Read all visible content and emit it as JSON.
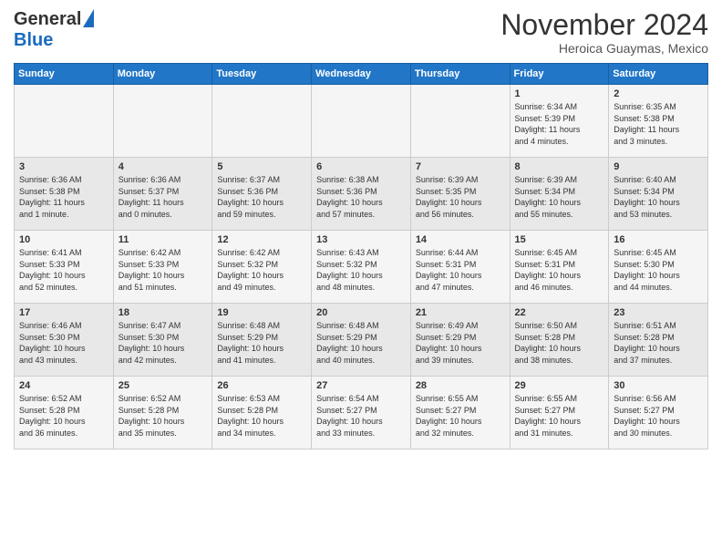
{
  "header": {
    "logo_general": "General",
    "logo_blue": "Blue",
    "month_title": "November 2024",
    "location": "Heroica Guaymas, Mexico"
  },
  "days_of_week": [
    "Sunday",
    "Monday",
    "Tuesday",
    "Wednesday",
    "Thursday",
    "Friday",
    "Saturday"
  ],
  "weeks": [
    [
      {
        "day": "",
        "info": ""
      },
      {
        "day": "",
        "info": ""
      },
      {
        "day": "",
        "info": ""
      },
      {
        "day": "",
        "info": ""
      },
      {
        "day": "",
        "info": ""
      },
      {
        "day": "1",
        "info": "Sunrise: 6:34 AM\nSunset: 5:39 PM\nDaylight: 11 hours\nand 4 minutes."
      },
      {
        "day": "2",
        "info": "Sunrise: 6:35 AM\nSunset: 5:38 PM\nDaylight: 11 hours\nand 3 minutes."
      }
    ],
    [
      {
        "day": "3",
        "info": "Sunrise: 6:36 AM\nSunset: 5:38 PM\nDaylight: 11 hours\nand 1 minute."
      },
      {
        "day": "4",
        "info": "Sunrise: 6:36 AM\nSunset: 5:37 PM\nDaylight: 11 hours\nand 0 minutes."
      },
      {
        "day": "5",
        "info": "Sunrise: 6:37 AM\nSunset: 5:36 PM\nDaylight: 10 hours\nand 59 minutes."
      },
      {
        "day": "6",
        "info": "Sunrise: 6:38 AM\nSunset: 5:36 PM\nDaylight: 10 hours\nand 57 minutes."
      },
      {
        "day": "7",
        "info": "Sunrise: 6:39 AM\nSunset: 5:35 PM\nDaylight: 10 hours\nand 56 minutes."
      },
      {
        "day": "8",
        "info": "Sunrise: 6:39 AM\nSunset: 5:34 PM\nDaylight: 10 hours\nand 55 minutes."
      },
      {
        "day": "9",
        "info": "Sunrise: 6:40 AM\nSunset: 5:34 PM\nDaylight: 10 hours\nand 53 minutes."
      }
    ],
    [
      {
        "day": "10",
        "info": "Sunrise: 6:41 AM\nSunset: 5:33 PM\nDaylight: 10 hours\nand 52 minutes."
      },
      {
        "day": "11",
        "info": "Sunrise: 6:42 AM\nSunset: 5:33 PM\nDaylight: 10 hours\nand 51 minutes."
      },
      {
        "day": "12",
        "info": "Sunrise: 6:42 AM\nSunset: 5:32 PM\nDaylight: 10 hours\nand 49 minutes."
      },
      {
        "day": "13",
        "info": "Sunrise: 6:43 AM\nSunset: 5:32 PM\nDaylight: 10 hours\nand 48 minutes."
      },
      {
        "day": "14",
        "info": "Sunrise: 6:44 AM\nSunset: 5:31 PM\nDaylight: 10 hours\nand 47 minutes."
      },
      {
        "day": "15",
        "info": "Sunrise: 6:45 AM\nSunset: 5:31 PM\nDaylight: 10 hours\nand 46 minutes."
      },
      {
        "day": "16",
        "info": "Sunrise: 6:45 AM\nSunset: 5:30 PM\nDaylight: 10 hours\nand 44 minutes."
      }
    ],
    [
      {
        "day": "17",
        "info": "Sunrise: 6:46 AM\nSunset: 5:30 PM\nDaylight: 10 hours\nand 43 minutes."
      },
      {
        "day": "18",
        "info": "Sunrise: 6:47 AM\nSunset: 5:30 PM\nDaylight: 10 hours\nand 42 minutes."
      },
      {
        "day": "19",
        "info": "Sunrise: 6:48 AM\nSunset: 5:29 PM\nDaylight: 10 hours\nand 41 minutes."
      },
      {
        "day": "20",
        "info": "Sunrise: 6:48 AM\nSunset: 5:29 PM\nDaylight: 10 hours\nand 40 minutes."
      },
      {
        "day": "21",
        "info": "Sunrise: 6:49 AM\nSunset: 5:29 PM\nDaylight: 10 hours\nand 39 minutes."
      },
      {
        "day": "22",
        "info": "Sunrise: 6:50 AM\nSunset: 5:28 PM\nDaylight: 10 hours\nand 38 minutes."
      },
      {
        "day": "23",
        "info": "Sunrise: 6:51 AM\nSunset: 5:28 PM\nDaylight: 10 hours\nand 37 minutes."
      }
    ],
    [
      {
        "day": "24",
        "info": "Sunrise: 6:52 AM\nSunset: 5:28 PM\nDaylight: 10 hours\nand 36 minutes."
      },
      {
        "day": "25",
        "info": "Sunrise: 6:52 AM\nSunset: 5:28 PM\nDaylight: 10 hours\nand 35 minutes."
      },
      {
        "day": "26",
        "info": "Sunrise: 6:53 AM\nSunset: 5:28 PM\nDaylight: 10 hours\nand 34 minutes."
      },
      {
        "day": "27",
        "info": "Sunrise: 6:54 AM\nSunset: 5:27 PM\nDaylight: 10 hours\nand 33 minutes."
      },
      {
        "day": "28",
        "info": "Sunrise: 6:55 AM\nSunset: 5:27 PM\nDaylight: 10 hours\nand 32 minutes."
      },
      {
        "day": "29",
        "info": "Sunrise: 6:55 AM\nSunset: 5:27 PM\nDaylight: 10 hours\nand 31 minutes."
      },
      {
        "day": "30",
        "info": "Sunrise: 6:56 AM\nSunset: 5:27 PM\nDaylight: 10 hours\nand 30 minutes."
      }
    ]
  ]
}
